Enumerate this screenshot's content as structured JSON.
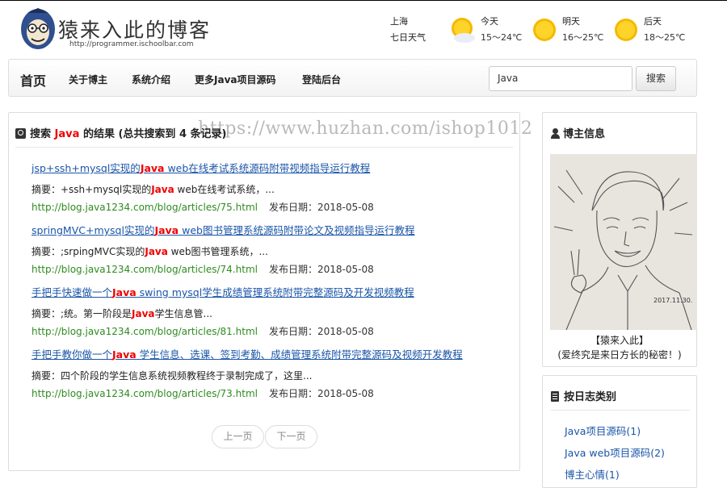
{
  "header": {
    "logo_title": "猿来入此的博客",
    "logo_url": "http://programmer.ischoolbar.com",
    "weather": {
      "city": "上海",
      "subtitle": "七日天气",
      "days": [
        {
          "name": "今天",
          "temp": "15～24℃"
        },
        {
          "name": "明天",
          "temp": "16～25℃"
        },
        {
          "name": "后天",
          "temp": "18～25℃"
        }
      ]
    }
  },
  "nav": {
    "brand": "首页",
    "items": [
      "关于博主",
      "系统介绍",
      "更多Java项目源码",
      "登陆后台"
    ],
    "search_value": "Java",
    "search_button": "搜索"
  },
  "main": {
    "head_prefix": "搜索",
    "keyword": "Java",
    "head_mid": "的结果",
    "head_count": "(总共搜索到 4 条记录)",
    "watermark": "https://www.huzhan.com/ishop1012",
    "results": [
      {
        "title_a": "jsp+ssh+mysql实现的",
        "title_kw": "Java",
        "title_b": " web在线考试系统源码附带视频指导运行教程",
        "sum_a": "摘要：+ssh+mysql实现的",
        "sum_kw": "Java",
        "sum_b": " web在线考试系统，...",
        "url": "http://blog.java1234.com/blog/articles/75.html",
        "date": "发布日期：2018-05-08"
      },
      {
        "title_a": "springMVC+mysql实现的",
        "title_kw": "Java",
        "title_b": " web图书管理系统源码附带论文及视频指导运行教程",
        "sum_a": "摘要：;srpingMVC实现的",
        "sum_kw": "Java",
        "sum_b": " web图书管理系统，...",
        "url": "http://blog.java1234.com/blog/articles/74.html",
        "date": "发布日期：2018-05-08"
      },
      {
        "title_a": "手把手快速做一个",
        "title_kw": "Java",
        "title_b": " swing mysql学生成绩管理系统附带完整源码及开发视频教程",
        "sum_a": "摘要：;统。第一阶段是",
        "sum_kw": "Java",
        "sum_b": "学生信息管...",
        "url": "http://blog.java1234.com/blog/articles/81.html",
        "date": "发布日期：2018-05-08"
      },
      {
        "title_a": "手把手教你做一个",
        "title_kw": "Java",
        "title_b": " 学生信息、选课、签到考勤、成绩管理系统附带完整源码及视频开发教程",
        "sum_a": "摘要：四个阶段的学生信息系统视频教程终于录制完成了，这里...",
        "sum_kw": "",
        "sum_b": "",
        "url": "http://blog.java1234.com/blog/articles/73.html",
        "date": "发布日期：2018-05-08"
      }
    ],
    "pager": {
      "prev": "上一页",
      "next": "下一页"
    }
  },
  "sidebar": {
    "blogger_title": "博主信息",
    "portrait_signature": "2017.11.30.",
    "caption1": "【猿来入此】",
    "caption2": "(爱终究是来日方长的秘密！)",
    "category_title": "按日志类别",
    "categories": [
      "Java项目源码(1)",
      "Java web项目源码(2)",
      "博主心情(1)"
    ]
  },
  "colors": {
    "link": "#1a55a8",
    "keyword": "#e00000",
    "url_green": "#2e8b1f"
  }
}
